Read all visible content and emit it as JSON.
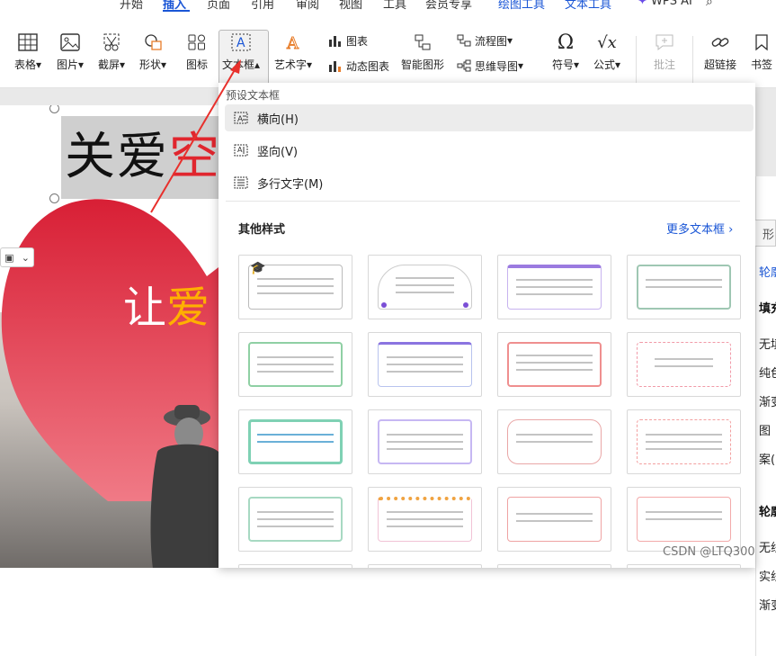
{
  "menu": {
    "tabs": [
      {
        "label": "开始"
      },
      {
        "label": "插入"
      },
      {
        "label": "页面"
      },
      {
        "label": "引用"
      },
      {
        "label": "审阅"
      },
      {
        "label": "视图"
      },
      {
        "label": "工具"
      },
      {
        "label": "会员专享"
      },
      {
        "label": "绘图工具"
      },
      {
        "label": "文本工具"
      },
      {
        "label": "WPS AI"
      }
    ]
  },
  "ribbon": {
    "table": "表格",
    "picture": "图片",
    "screenshot": "截屏",
    "shape": "形状",
    "icon": "图标",
    "textbox": "文本框",
    "wordart": "艺术字",
    "chart": "图表",
    "dynamic_chart": "动态图表",
    "smartart": "智能图形",
    "flowchart": "流程图",
    "mindmap": "思维导图",
    "symbol": "符号",
    "formula": "公式",
    "comment": "批注",
    "hyperlink": "超链接",
    "bookmark": "书签"
  },
  "slide": {
    "title_black": "关爱",
    "title_red": "空",
    "sub_white": "让",
    "sub_yellow": "爱"
  },
  "dropdown": {
    "header": "预设文本框",
    "options": [
      {
        "label": "横向(H)"
      },
      {
        "label": "竖向(V)"
      },
      {
        "label": "多行文字(M)"
      }
    ],
    "other_styles": "其他样式",
    "more_textboxes": "更多文本框"
  },
  "right_panel": {
    "tab": "形",
    "items": [
      "轮廓",
      "填充",
      "无填",
      "纯色",
      "渐变",
      "图",
      "案(I",
      "轮廓",
      "无线",
      "实线",
      "渐变"
    ]
  },
  "watermark": "CSDN @LTQ300",
  "colors": {
    "accent": "#1a56d6",
    "arrow": "#e8302c",
    "heart": "#e22a3b"
  }
}
